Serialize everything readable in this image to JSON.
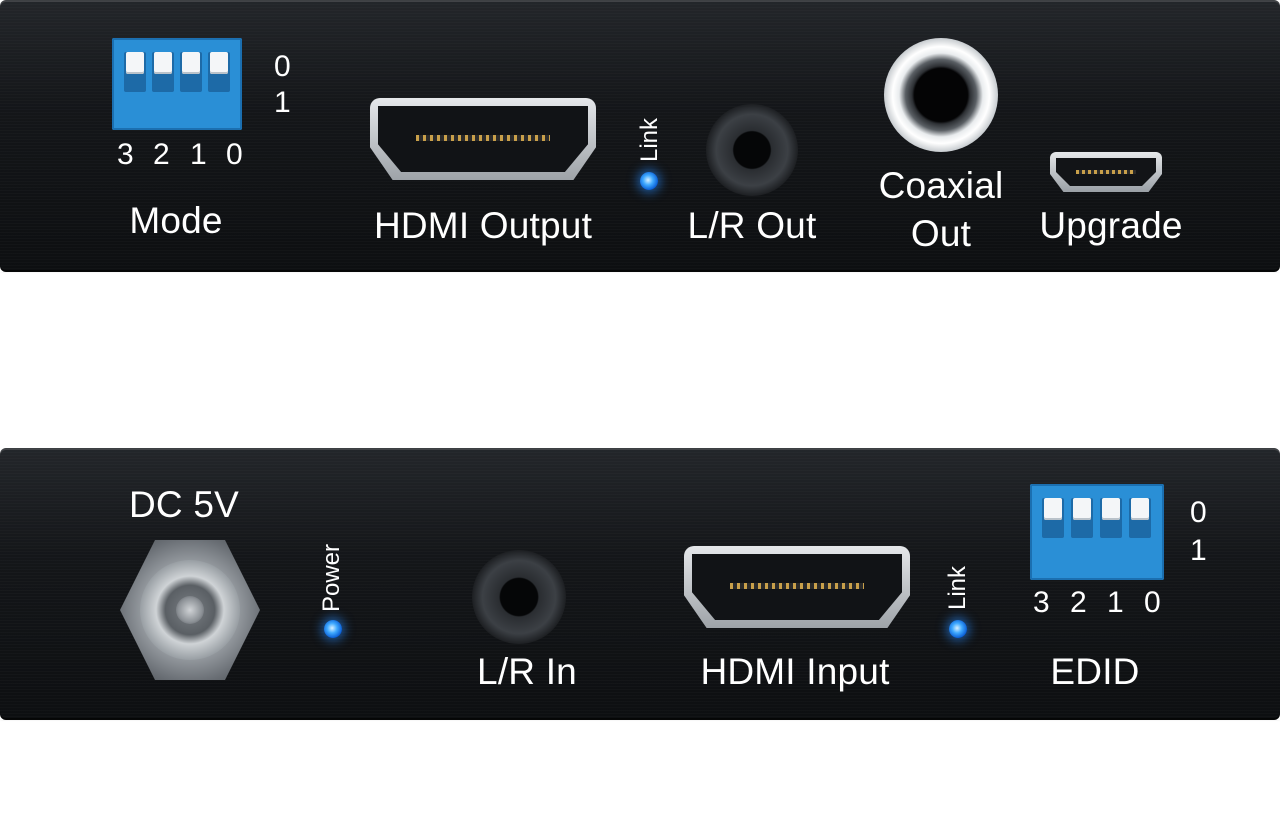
{
  "receiver": {
    "dip_switch": {
      "positions": [
        "3",
        "2",
        "1",
        "0"
      ],
      "states": [
        "0",
        "1"
      ],
      "label": "Mode"
    },
    "hdmi_port": {
      "label": "HDMI Output"
    },
    "link_led": {
      "label": "Link"
    },
    "audio_jack": {
      "label": "L/R Out"
    },
    "coaxial": {
      "label_line1": "Coaxial",
      "label_line2": "Out"
    },
    "usb_port": {
      "label": "Upgrade"
    }
  },
  "transmitter": {
    "power_input": {
      "label": "DC 5V"
    },
    "power_led": {
      "label": "Power"
    },
    "audio_jack": {
      "label": "L/R In"
    },
    "hdmi_port": {
      "label": "HDMI Input"
    },
    "link_led": {
      "label": "Link"
    },
    "dip_switch": {
      "positions": [
        "3",
        "2",
        "1",
        "0"
      ],
      "states": [
        "0",
        "1"
      ],
      "label": "EDID"
    }
  },
  "colors": {
    "panel": "#141619",
    "label_text": "#ffffff",
    "led_blue": "#3fa9ff",
    "dip_blue": "#2a8fd6"
  }
}
